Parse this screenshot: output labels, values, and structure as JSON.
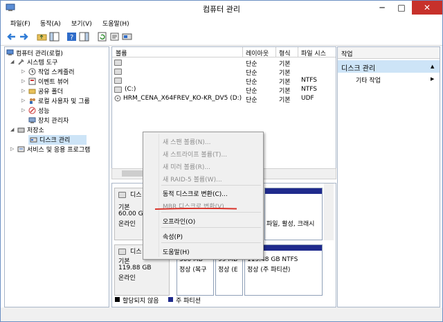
{
  "window": {
    "title": "컴퓨터 관리",
    "minimize": "─",
    "maximize": "□",
    "close": "✕"
  },
  "menu": [
    "파일(F)",
    "동작(A)",
    "보기(V)",
    "도움말(H)"
  ],
  "tree": {
    "root": "컴퓨터 관리(로컬)",
    "system_tools": "시스템 도구",
    "items": [
      "작업 스케줄러",
      "이벤트 뷰어",
      "공유 폴더",
      "로컬 사용자 및 그룹",
      "성능",
      "장치 관리자"
    ],
    "storage": "저장소",
    "disk_mgmt": "디스크 관리",
    "services": "서비스 및 응용 프로그램"
  },
  "volumes": {
    "columns": [
      "볼륨",
      "레이아웃",
      "형식",
      "파일 시스"
    ],
    "rows": [
      {
        "name": "",
        "layout": "단순",
        "type": "기본",
        "fs": ""
      },
      {
        "name": "",
        "layout": "단순",
        "type": "기본",
        "fs": ""
      },
      {
        "name": "",
        "layout": "단순",
        "type": "기본",
        "fs": "NTFS"
      },
      {
        "name": "(C:)",
        "layout": "단순",
        "type": "기본",
        "fs": "NTFS"
      },
      {
        "name": "HRM_CENA_X64FREV_KO-KR_DV5 (D:)",
        "layout": "단순",
        "type": "기본",
        "fs": "UDF"
      }
    ]
  },
  "disks": [
    {
      "name": "디스",
      "type": "기본",
      "size": "60.00 GB",
      "status": "온라인",
      "partitions": [
        {
          "l1": "",
          "l2": "파일, 활성, 크래시"
        }
      ]
    },
    {
      "name": "디스",
      "type": "기본",
      "size": "119.88 GB",
      "status": "온라인",
      "partitions": [
        {
          "l1": "300 MB",
          "l2": "정상 (복구"
        },
        {
          "l1": "99 MB",
          "l2": "정상 (E"
        },
        {
          "l1": "119.48 GB NTFS",
          "l2": "정상 (주 파티션)"
        }
      ]
    }
  ],
  "legend": {
    "unallocated": "할당되지 않음",
    "primary": "주 파티션"
  },
  "actions": {
    "header": "작업",
    "selected": "디스크 관리",
    "more": "기타 작업",
    "arrow": "▶"
  },
  "context_menu": [
    {
      "label": "새 스팬 볼륨(N)...",
      "disabled": true
    },
    {
      "label": "새 스트라이프 볼륨(T)...",
      "disabled": true
    },
    {
      "label": "새 미러 볼륨(R)...",
      "disabled": true
    },
    {
      "label": "새 RAID-5 볼륨(W)...",
      "disabled": true
    },
    {
      "label": "동적 디스크로 변환(C)...",
      "disabled": false
    },
    {
      "label": "MBR 디스크로 변환(V)",
      "disabled": true
    },
    {
      "label": "오프라인(O)",
      "disabled": false
    },
    {
      "label": "속성(P)",
      "disabled": false
    },
    {
      "label": "도움말(H)",
      "disabled": false
    }
  ],
  "colors": {
    "primary_partition": "#1f2a8c",
    "selection": "#cde4f7",
    "close_button": "#c7312b",
    "underline": "#d9342b"
  }
}
